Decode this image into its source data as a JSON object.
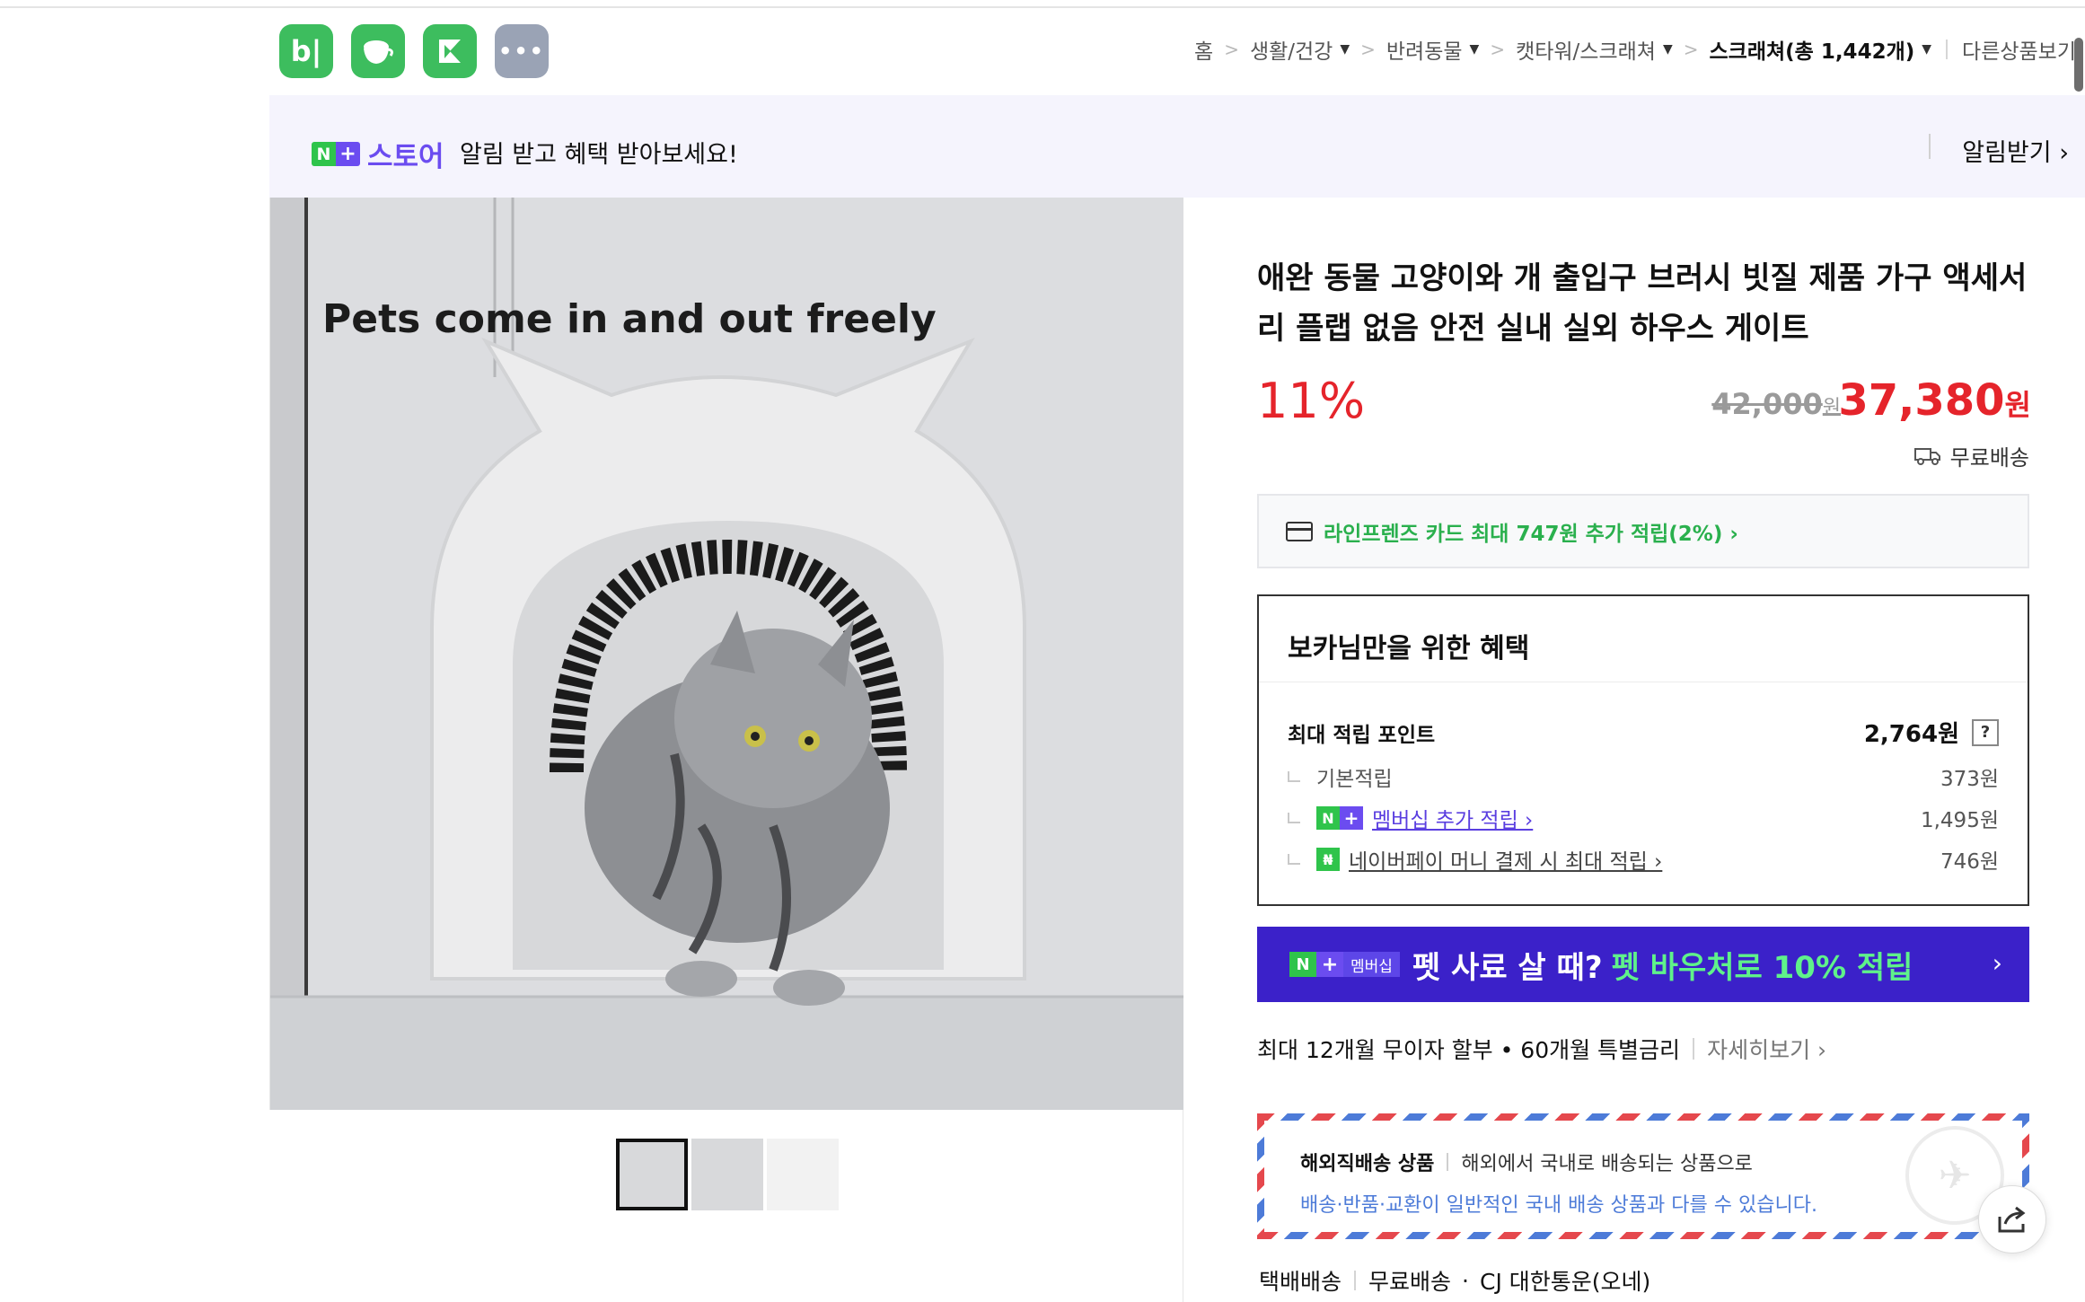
{
  "apps": [
    {
      "name": "blog-app-icon",
      "glyph": "b|",
      "style": "green"
    },
    {
      "name": "cafe-app-icon",
      "glyph": "☕",
      "style": "green"
    },
    {
      "name": "bookmark-app-icon",
      "glyph": "◣",
      "style": "green"
    },
    {
      "name": "more-apps-icon",
      "glyph": "•••",
      "style": "gray"
    }
  ],
  "breadcrumb": {
    "home": "홈",
    "items": [
      "생활/건강",
      "반려동물",
      "캣타워/스크래쳐"
    ],
    "current": "스크래쳐(총 1,442개)",
    "other": "다른상품보기"
  },
  "store_banner": {
    "n": "N",
    "plus": "+",
    "store": "스토어",
    "message": "알림 받고 혜택 받아보세요!",
    "alarm": "알림받기 ›"
  },
  "image": {
    "caption": "Pets come in and out freely"
  },
  "product": {
    "title": "애완 동물 고양이와 개 출입구 브러시 빗질 제품 가구 액세서리 플랩 없음 안전 실내 실외 하우스 게이트",
    "discount": "11%",
    "original_price": "42,000",
    "original_unit": "원",
    "sale_price": "37,380",
    "sale_unit": "원",
    "shipping": "무료배송"
  },
  "card_offer": "라인프렌즈 카드 최대 747원 추가 적립(2%) ›",
  "benefits": {
    "title": "보카님만을 위한 혜택",
    "max_points_label": "최대 적립 포인트",
    "max_points_value": "2,764원",
    "help": "?",
    "basic_label": "기본적립",
    "basic_value": "373원",
    "membership_label": "멤버십 추가 적립 ›",
    "membership_value": "1,495원",
    "pay_label": "네이버페이 머니 결제 시 최대 적립 ›",
    "pay_value": "746원"
  },
  "membership_banner": {
    "badge_label": "멤버십",
    "text": "펫 사료 살 때?",
    "accent": "펫 바우처로 10% 적립",
    "arrow": "›"
  },
  "installment": {
    "text": "최대 12개월 무이자 할부 • 60개월 특별금리",
    "more": "자세히보기 ›"
  },
  "overseas": {
    "title": "해외직배송 상품",
    "desc": "해외에서 국내로 배송되는 상품으로",
    "note": "배송·반품·교환이 일반적인 국내 배송 상품과 다를 수 있습니다."
  },
  "delivery": {
    "method": "택배배송",
    "fee": "무료배송",
    "carrier": "CJ 대한통운(오네)"
  },
  "colors": {
    "accent_red": "#e5242b",
    "naver_green": "#2fc44b",
    "membership_purple": "#3b21c9"
  }
}
